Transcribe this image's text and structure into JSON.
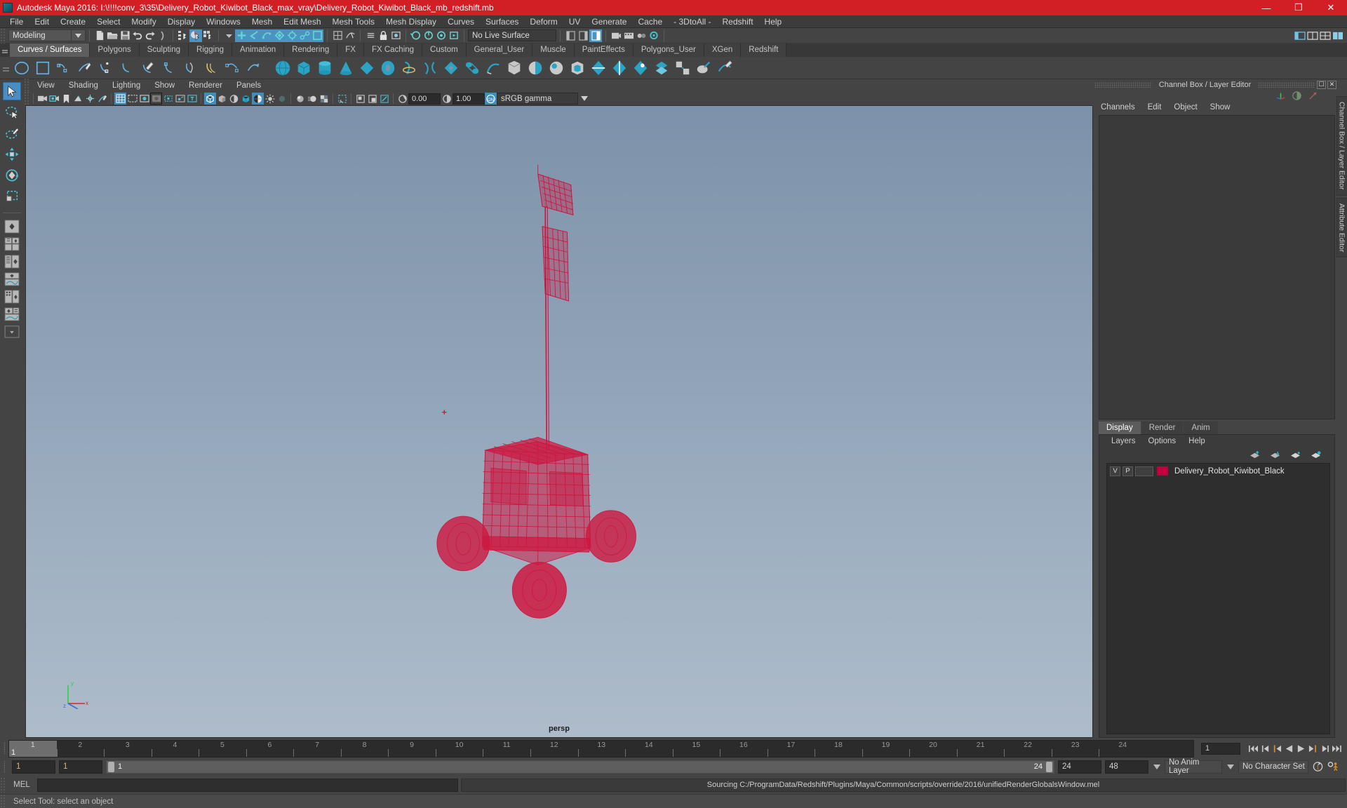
{
  "titlebar": {
    "title": "Autodesk Maya 2016: I:\\!!!!conv_3\\35\\Delivery_Robot_Kiwibot_Black_max_vray\\Delivery_Robot_Kiwibot_Black_mb_redshift.mb",
    "minimize": "—",
    "maximize": "❐",
    "close": "✕",
    "brand_color": "#d21f26"
  },
  "menubar": {
    "items": [
      "File",
      "Edit",
      "Create",
      "Select",
      "Modify",
      "Display",
      "Windows",
      "Mesh",
      "Edit Mesh",
      "Mesh Tools",
      "Mesh Display",
      "Curves",
      "Surfaces",
      "Deform",
      "UV",
      "Generate",
      "Cache",
      "- 3DtoAll -",
      "Redshift",
      "Help"
    ]
  },
  "statusline": {
    "menu_set": "Modeling",
    "live_surface": "No Live Surface"
  },
  "shelf": {
    "tabs": [
      "Curves / Surfaces",
      "Polygons",
      "Sculpting",
      "Rigging",
      "Animation",
      "Rendering",
      "FX",
      "FX Caching",
      "Custom",
      "General_User",
      "Muscle",
      "PaintEffects",
      "Polygons_User",
      "XGen",
      "Redshift"
    ],
    "active_tab": "Curves / Surfaces"
  },
  "viewport": {
    "menus": [
      "View",
      "Shading",
      "Lighting",
      "Show",
      "Renderer",
      "Panels"
    ],
    "exposure": "0.00",
    "gamma": "1.00",
    "color_space": "sRGB gamma",
    "camera_label": "persp",
    "model_color": "#d0103a"
  },
  "channelbox": {
    "panel_title": "Channel Box / Layer Editor",
    "menus": [
      "Channels",
      "Edit",
      "Object",
      "Show"
    ]
  },
  "layer_editor": {
    "tabs": [
      "Display",
      "Render",
      "Anim"
    ],
    "active_tab": "Display",
    "menus": [
      "Layers",
      "Options",
      "Help"
    ],
    "layers": [
      {
        "visible": "V",
        "playback": "P",
        "type": "",
        "color": "#c2003f",
        "name": "Delivery_Robot_Kiwibot_Black"
      }
    ]
  },
  "right_strip": {
    "tabs": [
      "Channel Box / Layer Editor",
      "Attribute Editor"
    ]
  },
  "timeline": {
    "frames": [
      "1",
      "2",
      "3",
      "4",
      "5",
      "6",
      "7",
      "8",
      "9",
      "10",
      "11",
      "12",
      "13",
      "14",
      "15",
      "16",
      "17",
      "18",
      "19",
      "20",
      "21",
      "22",
      "23",
      "24"
    ],
    "current_frame_marker": "1",
    "current_frame_field": "1"
  },
  "range": {
    "start": "1",
    "start2": "1",
    "range_min": "1",
    "range_max": "24",
    "end": "24",
    "playback_end": "48",
    "anim_layer": "No Anim Layer",
    "character_set": "No Character Set"
  },
  "mel": {
    "label": "MEL",
    "input": "",
    "output": "Sourcing C:/ProgramData/Redshift/Plugins/Maya/Common/scripts/override/2016/unifiedRenderGlobalsWindow.mel"
  },
  "helpline": {
    "text": "Select Tool: select an object"
  }
}
